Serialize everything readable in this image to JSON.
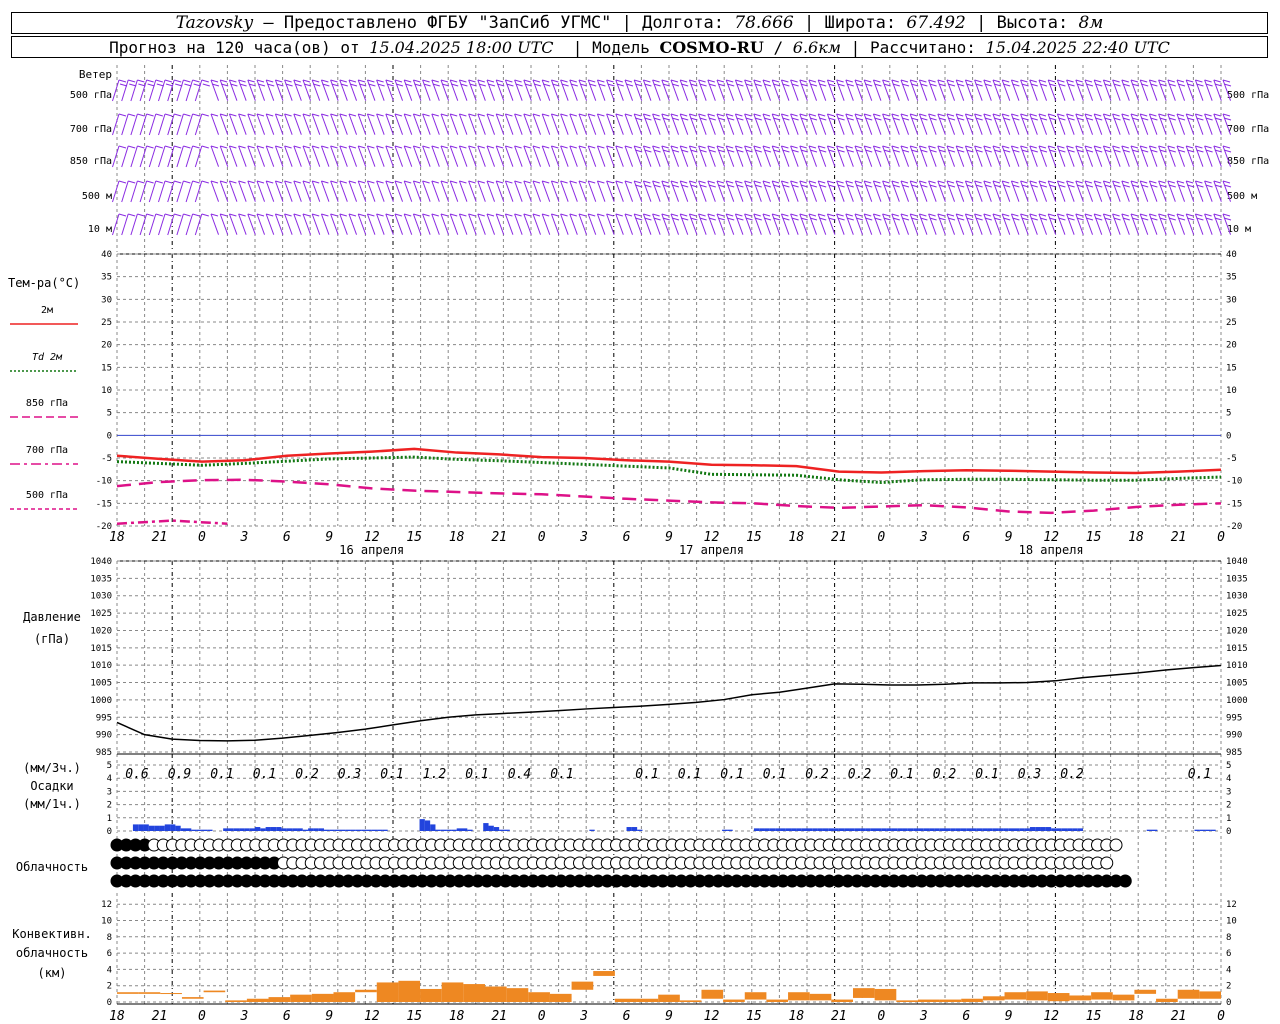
{
  "header": {
    "station": "Tazovsky",
    "provider": "Предоставлено ФГБУ \"ЗапСиб УГМС\"",
    "lon_label": "Долгота:",
    "lon": "78.666",
    "lat_label": "Широта:",
    "lat": "67.492",
    "alt_label": "Высота:",
    "alt": "8м",
    "forecast_prefix": "Прогноз на 120 часа(ов) от",
    "forecast_start": "15.04.2025 18:00 UTC",
    "model_label": "Модель",
    "model": "COSMO-RU",
    "resolution": "6.6км",
    "computed_label": "Рассчитано:",
    "computed": "15.04.2025 22:40 UTC"
  },
  "labels": {
    "wind": "Ветер",
    "wind_levels": [
      "500 гПа",
      "700 гПа",
      "850 гПа",
      "500 м",
      "10 м"
    ],
    "temp": "Тем-ра(°C)",
    "temp_series": [
      "2м",
      "Td 2м",
      "850 гПа",
      "700 гПа",
      "500 гПа"
    ],
    "pressure": "Давление",
    "pressure_unit": "(гПа)",
    "precip_top": "(мм/3ч.)",
    "precip": "Осадки",
    "precip_bottom": "(мм/1ч.)",
    "clouds": "Облачность",
    "conv1": "Конвективн.",
    "conv2": "облачность",
    "conv3": "(км)"
  },
  "time_axis": {
    "ticks": [
      "18",
      "21",
      "0",
      "3",
      "6",
      "9",
      "12",
      "15",
      "18",
      "21",
      "0",
      "3",
      "6",
      "9",
      "12",
      "15",
      "18",
      "21",
      "0",
      "3",
      "6",
      "9",
      "12",
      "15",
      "18",
      "21",
      "0"
    ],
    "days": [
      "16 апреля",
      "17 апреля",
      "18 апреля"
    ]
  },
  "colors": {
    "wind": "#8a2be2",
    "t2m": "#ee2222",
    "td2m": "#117711",
    "t850": "#dd1188",
    "t700": "#dd1188",
    "t500": "#dd1188",
    "pressure": "#000000",
    "precip": "#2244dd",
    "conv": "#ee8822",
    "zero_line": "#3344cc",
    "grid": "#888888"
  },
  "chart_data": [
    {
      "type": "line",
      "title": "Тем-ра(°C)",
      "x_hours": [
        0,
        3,
        6,
        9,
        12,
        15,
        18,
        21,
        24,
        27,
        30,
        33,
        36,
        39,
        42,
        45,
        48,
        51,
        54,
        57,
        60,
        63,
        66,
        69,
        72,
        75,
        78
      ],
      "ylim": [
        -20,
        40
      ],
      "yticks": [
        -20,
        -15,
        -10,
        -5,
        0,
        5,
        10,
        15,
        20,
        25,
        30,
        35,
        40
      ],
      "series": [
        {
          "name": "2м",
          "style": "solid",
          "values": [
            -4.5,
            -5.2,
            -5.8,
            -5.5,
            -4.5,
            -4.0,
            -3.6,
            -3.0,
            -3.8,
            -4.2,
            -4.8,
            -5.0,
            -5.5,
            -5.8,
            -6.5,
            -6.6,
            -6.8,
            -8.0,
            -8.2,
            -7.9,
            -7.7,
            -7.8,
            -8.0,
            -8.2,
            -8.3,
            -8.0,
            -7.6
          ]
        },
        {
          "name": "Td 2м",
          "style": "dotted",
          "values": [
            -5.8,
            -6.2,
            -6.6,
            -6.2,
            -5.7,
            -5.2,
            -5.0,
            -4.8,
            -5.3,
            -5.6,
            -6.0,
            -6.4,
            -6.8,
            -7.2,
            -8.6,
            -8.7,
            -8.8,
            -9.8,
            -10.4,
            -9.8,
            -9.7,
            -9.7,
            -9.8,
            -9.9,
            -9.9,
            -9.5,
            -9.2
          ]
        },
        {
          "name": "700 гПа",
          "style": "dashdot",
          "values": [
            -19.5,
            -18.8,
            -19.5
          ]
        },
        {
          "name": "500 гПа",
          "style": "dashed",
          "values": [
            -11.2,
            -10.3,
            -9.9,
            -9.8,
            -10.2,
            -10.8,
            -11.7,
            -12.2,
            -12.5,
            -12.8,
            -13.0,
            -13.5,
            -14.0,
            -14.4,
            -14.8,
            -15.0,
            -15.6,
            -16.0,
            -15.7,
            -15.4,
            -15.9,
            -16.8,
            -17.1,
            -16.6,
            -15.8,
            -15.3,
            -15.0
          ]
        }
      ]
    },
    {
      "type": "line",
      "title": "Давление",
      "ylim": [
        985,
        1040
      ],
      "yticks": [
        985,
        990,
        995,
        1000,
        1005,
        1010,
        1015,
        1020,
        1025,
        1030,
        1035,
        1040
      ],
      "x_hours": [
        0,
        3,
        6,
        9,
        12,
        15,
        18,
        21,
        24,
        27,
        30,
        33,
        36,
        39,
        42,
        45,
        48,
        51,
        54,
        57,
        60,
        63,
        66,
        69,
        72,
        75,
        78,
        81,
        84,
        87,
        90,
        93,
        96,
        99,
        102,
        105,
        108,
        111,
        114,
        117,
        120
      ],
      "series": [
        {
          "name": "Давление",
          "values": [
            993.5,
            990,
            988.7,
            988.3,
            988.2,
            988.4,
            989,
            989.8,
            990.6,
            991.6,
            992.8,
            994,
            995,
            995.7,
            996.1,
            996.5,
            996.9,
            997.4,
            997.8,
            998.2,
            998.7,
            999.3,
            1000.1,
            1001.5,
            1002.2,
            1003.4,
            1004.6,
            1004.5,
            1004.3,
            1004.3,
            1004.5,
            1004.9,
            1004.9,
            1005,
            1005.5,
            1006.4,
            1007.1,
            1007.8,
            1008.6,
            1009.3,
            1009.9
          ]
        }
      ]
    },
    {
      "type": "bar",
      "title": "Осадки",
      "ylim": [
        0,
        5
      ],
      "yticks": [
        0,
        1,
        2,
        3,
        4,
        5
      ],
      "labels_3h": [
        "0.6",
        "0.9",
        "0.1",
        "0.1",
        "0.2",
        "0.3",
        "0.1",
        "1.2",
        "0.1",
        "0.4",
        "0.1",
        "",
        "0.1",
        "0.1",
        "0.1",
        "0.1",
        "0.2",
        "0.2",
        "0.1",
        "0.2",
        "0.1",
        "0.3",
        "0.2",
        "",
        "",
        "0.1"
      ],
      "hourly": [
        0,
        0,
        0,
        0.5,
        0.5,
        0.5,
        0.4,
        0.4,
        0.4,
        0.5,
        0.5,
        0.4,
        0.2,
        0.2,
        0.1,
        0.1,
        0.1,
        0.1,
        0,
        0,
        0.2,
        0.2,
        0.2,
        0.2,
        0.2,
        0.2,
        0.3,
        0.2,
        0.3,
        0.3,
        0.3,
        0.2,
        0.2,
        0.2,
        0.2,
        0.1,
        0.2,
        0.2,
        0.2,
        0.1,
        0.1,
        0.1,
        0.1,
        0.1,
        0.1,
        0.1,
        0.1,
        0.1,
        0.1,
        0.1,
        0.1,
        0,
        0,
        0,
        0,
        0,
        0,
        0.9,
        0.8,
        0.5,
        0.1,
        0.1,
        0.1,
        0.1,
        0.2,
        0.2,
        0.1,
        0,
        0,
        0.6,
        0.4,
        0.3,
        0.1,
        0.1,
        0,
        0,
        0,
        0,
        0,
        0,
        0,
        0,
        0,
        0,
        0,
        0,
        0,
        0,
        0,
        0.1,
        0,
        0,
        0,
        0,
        0,
        0,
        0.3,
        0.3,
        0.1,
        0,
        0,
        0,
        0,
        0,
        0,
        0,
        0,
        0,
        0,
        0,
        0,
        0,
        0,
        0,
        0.1,
        0.1,
        0,
        0,
        0,
        0,
        0.2,
        0.2,
        0.2,
        0.2,
        0.2,
        0.2,
        0.2,
        0.2,
        0.2,
        0.2,
        0.2,
        0.2,
        0.2,
        0.2,
        0.2,
        0.2,
        0.2,
        0.2,
        0.2,
        0.2,
        0.2,
        0.2,
        0.2,
        0.2,
        0.2,
        0.2,
        0.2,
        0.2,
        0.2,
        0.2,
        0.2,
        0.2,
        0.2,
        0.2,
        0.2,
        0.2,
        0.2,
        0.2,
        0.2,
        0.2,
        0.2,
        0.2,
        0.2,
        0.2,
        0.2,
        0.2,
        0.2,
        0.2,
        0.2,
        0.2,
        0.2,
        0.2,
        0.3,
        0.3,
        0.3,
        0.3,
        0.2,
        0.2,
        0.2,
        0.2,
        0.2,
        0.2,
        0,
        0,
        0,
        0,
        0,
        0,
        0,
        0,
        0,
        0,
        0,
        0,
        0.1,
        0.1,
        0,
        0,
        0,
        0,
        0,
        0,
        0,
        0.1,
        0.1,
        0.1,
        0.1,
        0
      ]
    },
    {
      "type": "table",
      "title": "Облачность",
      "rows": [
        "FFFFHHHHHHHHHHHHHHHHHHHHHHHHHHHHHHHHHHHHHHHHHHHHHHHHHHHHHHHHHHHHHHHHHHHHHHHHHHHHHHHHHHHHHHHHHHHHHHHHHHHHHHHHH",
        "FFFFFFFFFFFFFFFFFFHHHHHHHHHHHHHHHHHHHHHHHHHHHHHHHHHHHHHHHHHHHHHHHHHHHHHHHHHHHHHHHHHHHHHHHHHHHHHHHHHHHHHHHHHH",
        "FFFFFFFFFFFFFFFFFFFFFFFFFFFFFFFFFFFFFFFFFFFFFFFFFFFFFFFFFFFFFFFFFFFFFFFFFFFFFFFFFFFFFFFFFFFFFFFFFFFFFFFFFFFFFF"
      ]
    },
    {
      "type": "bar",
      "title": "Конвективн. облачность",
      "ylim": [
        0,
        13
      ],
      "yticks": [
        0,
        2,
        4,
        6,
        8,
        10,
        12
      ],
      "bars": [
        [
          0,
          1.2,
          1.0
        ],
        [
          1,
          1.2,
          1.0
        ],
        [
          2,
          1.1,
          1.0
        ],
        [
          3,
          0.6,
          0.4
        ],
        [
          4,
          1.4,
          1.2
        ],
        [
          5,
          0.2,
          0
        ],
        [
          6,
          0.4,
          0
        ],
        [
          7,
          0.6,
          0
        ],
        [
          8,
          0.9,
          0
        ],
        [
          9,
          1.0,
          0
        ],
        [
          10,
          1.2,
          0
        ],
        [
          11,
          1.5,
          1.2
        ],
        [
          12,
          2.4,
          0
        ],
        [
          13,
          2.6,
          0
        ],
        [
          14,
          1.6,
          0
        ],
        [
          15,
          2.4,
          0
        ],
        [
          16,
          2.2,
          0
        ],
        [
          17,
          1.9,
          0
        ],
        [
          18,
          1.7,
          0
        ],
        [
          19,
          1.2,
          0
        ],
        [
          20,
          1.0,
          0
        ],
        [
          21,
          2.5,
          1.5
        ],
        [
          22,
          3.8,
          3.2
        ],
        [
          23,
          0.4,
          0
        ],
        [
          24,
          0.4,
          0
        ],
        [
          25,
          0.9,
          0
        ],
        [
          26,
          0.2,
          0
        ],
        [
          27,
          1.5,
          0.4
        ],
        [
          28,
          0.3,
          0
        ],
        [
          29,
          1.2,
          0.3
        ],
        [
          30,
          0.3,
          0
        ],
        [
          31,
          1.2,
          0.2
        ],
        [
          32,
          1.0,
          0.2
        ],
        [
          33,
          0.3,
          0
        ],
        [
          34,
          1.7,
          0.5
        ],
        [
          35,
          1.6,
          0.2
        ],
        [
          36,
          0.2,
          0
        ],
        [
          37,
          0.3,
          0
        ],
        [
          38,
          0.3,
          0
        ],
        [
          39,
          0.4,
          0
        ],
        [
          40,
          0.7,
          0.2
        ],
        [
          41,
          1.2,
          0.3
        ],
        [
          42,
          1.3,
          0.2
        ],
        [
          43,
          1.1,
          0.1
        ],
        [
          44,
          0.8,
          0.2
        ],
        [
          45,
          1.2,
          0.3
        ],
        [
          46,
          0.9,
          0.2
        ],
        [
          47,
          1.5,
          1.0
        ],
        [
          48,
          0.4,
          0
        ],
        [
          49,
          1.5,
          0.4
        ],
        [
          50,
          1.3,
          0.4
        ]
      ]
    }
  ]
}
